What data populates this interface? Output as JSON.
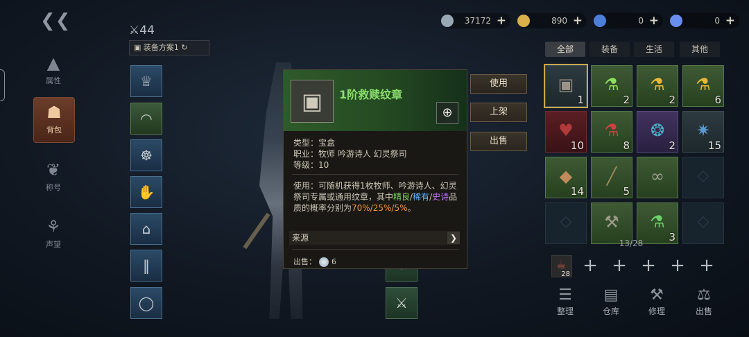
{
  "nav": {
    "items": [
      {
        "label": "属性",
        "icon": "attribute-icon"
      },
      {
        "label": "背包",
        "icon": "backpack-icon",
        "active": true
      },
      {
        "label": "称号",
        "icon": "title-icon"
      },
      {
        "label": "声望",
        "icon": "reputation-icon"
      }
    ]
  },
  "character": {
    "level": "44",
    "plan": "装备方案1"
  },
  "currencies": [
    {
      "value": "37172",
      "color": "#9aa7b4"
    },
    {
      "value": "890",
      "color": "#d9b04a"
    },
    {
      "value": "0",
      "color": "#4b7fd9"
    },
    {
      "value": "0",
      "color": "#6a8ef0"
    }
  ],
  "tabs": [
    "全部",
    "装备",
    "生活",
    "其他"
  ],
  "inventory": {
    "items": [
      {
        "icon": "treasure-chest",
        "count": "1",
        "q": "gr",
        "sel": true
      },
      {
        "icon": "green-potion",
        "count": "2",
        "q": "g"
      },
      {
        "icon": "yellow-potion",
        "count": "2",
        "q": "g"
      },
      {
        "icon": "yellow-potion",
        "count": "6",
        "q": "g"
      },
      {
        "icon": "red-item",
        "count": "10",
        "q": "r"
      },
      {
        "icon": "red-potion",
        "count": "8",
        "q": "g"
      },
      {
        "icon": "purple-relic",
        "count": "2",
        "q": "p"
      },
      {
        "icon": "blue-relic",
        "count": "15",
        "q": "gr"
      },
      {
        "icon": "ore",
        "count": "14",
        "q": "g"
      },
      {
        "icon": "wood",
        "count": "5",
        "q": "g"
      },
      {
        "icon": "chain",
        "count": "",
        "q": "g"
      },
      {
        "icon": "empty",
        "count": "",
        "q": "empty"
      },
      {
        "icon": "empty",
        "count": "",
        "q": "empty"
      },
      {
        "icon": "hammer",
        "count": "",
        "q": "g"
      },
      {
        "icon": "green-flask",
        "count": "3",
        "q": "g"
      },
      {
        "icon": "empty",
        "count": "",
        "q": "empty"
      }
    ],
    "page": "13/28",
    "quickslot_count": "28"
  },
  "bottom_actions": [
    "整理",
    "仓库",
    "修理",
    "出售"
  ],
  "tooltip": {
    "name": "1阶救赎纹章",
    "type": "类型：宝盒",
    "job": "职业：牧师 吟游诗人 幻灵祭司",
    "level": "等级：10",
    "desc_1": "使用：可随机获得1枚牧师、吟游诗人、幻灵祭司专属或通用纹章，其中",
    "q1": "精良",
    "s1": "/",
    "q2": "稀有",
    "s2": "/",
    "q3": "史诗",
    "desc_2": "品质的概率分别为",
    "probs": "70%/25%/5%",
    "desc_3": "。",
    "source": "来源",
    "sell_label": "出售：",
    "sell_value": "6"
  },
  "actions": {
    "use": "使用",
    "list": "上架",
    "sell": "出售"
  }
}
